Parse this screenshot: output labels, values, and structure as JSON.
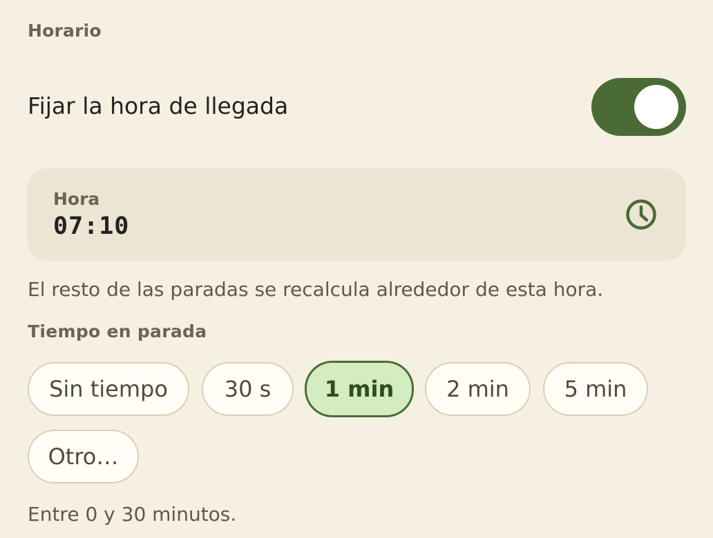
{
  "section": {
    "title": "Horario"
  },
  "arrival": {
    "label": "Fijar la hora de llegada",
    "enabled": true
  },
  "time_field": {
    "label": "Hora",
    "value": "07:10",
    "icon": "clock-icon"
  },
  "helper_text": "El resto de las paradas se recalcula alrededor de esta hora.",
  "stop_time": {
    "title": "Tiempo en parada",
    "options": [
      {
        "label": "Sin tiempo",
        "selected": false
      },
      {
        "label": "30 s",
        "selected": false
      },
      {
        "label": "1 min",
        "selected": true
      },
      {
        "label": "2 min",
        "selected": false
      },
      {
        "label": "5 min",
        "selected": false
      },
      {
        "label": "Otro…",
        "selected": false
      }
    ],
    "note": "Entre 0 y 30 minutos."
  },
  "colors": {
    "background": "#f6f0e2",
    "accent": "#4a6a36",
    "selected_chip": "#d3ecc0",
    "field_background": "#ece5d4"
  }
}
